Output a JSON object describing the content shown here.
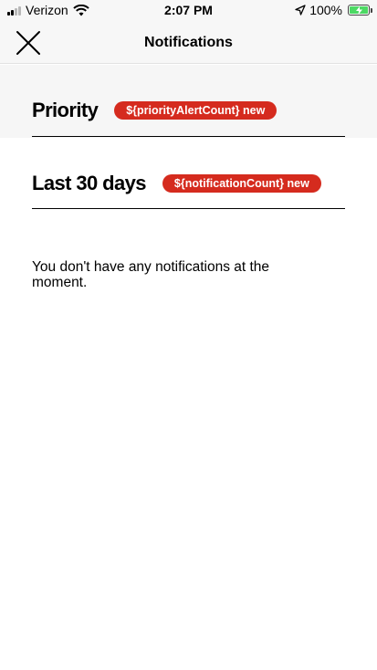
{
  "status_bar": {
    "carrier": "Verizon",
    "time": "2:07 PM",
    "battery": "100%"
  },
  "nav": {
    "title": "Notifications"
  },
  "sections": {
    "priority": {
      "title": "Priority",
      "badge": "${priorityAlertCount} new"
    },
    "last30": {
      "title": "Last 30 days",
      "badge": "${notificationCount} new"
    }
  },
  "empty_message": "You don't have any notifications at the moment.",
  "colors": {
    "badge": "#d52b1e",
    "battery": "#4cd964"
  }
}
